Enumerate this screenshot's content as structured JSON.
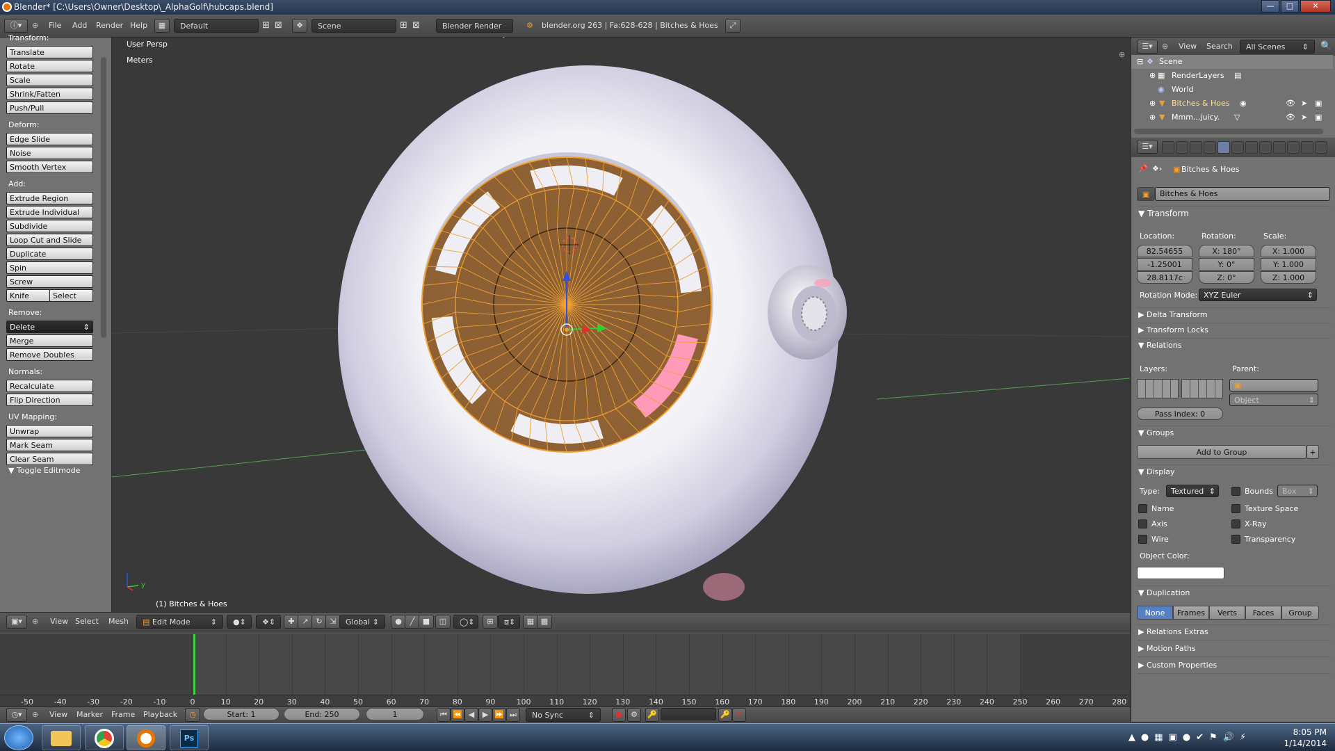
{
  "titlebar": {
    "title": "Blender* [C:\\Users\\Owner\\Desktop\\_AlphaGolf\\hubcaps.blend]"
  },
  "info_header": {
    "menus": [
      "File",
      "Add",
      "Render",
      "Help"
    ],
    "layout": "Default",
    "scene": "Scene",
    "engine": "Blender Render",
    "stats": "blender.org 263 | Fa:628-628 | Bitches & Hoes"
  },
  "toolshelf": {
    "transform_label": "Transform:",
    "transform": [
      "Translate",
      "Rotate",
      "Scale",
      "Shrink/Fatten",
      "Push/Pull"
    ],
    "deform_label": "Deform:",
    "deform": [
      "Edge Slide",
      "Noise",
      "Smooth Vertex"
    ],
    "add_label": "Add:",
    "add": [
      "Extrude Region",
      "Extrude Individual",
      "Subdivide",
      "Loop Cut and Slide",
      "Duplicate",
      "Spin",
      "Screw"
    ],
    "knife": "Knife",
    "select": "Select",
    "remove_label": "Remove:",
    "delete": "Delete",
    "remove": [
      "Merge",
      "Remove Doubles"
    ],
    "normals_label": "Normals:",
    "normals": [
      "Recalculate",
      "Flip Direction"
    ],
    "uv_label": "UV Mapping:",
    "uv": [
      "Unwrap",
      "Mark Seam",
      "Clear Seam"
    ],
    "toggle": "Toggle Editmode"
  },
  "viewport": {
    "view_name": "User Persp",
    "units": "Meters",
    "object_label": "(1) Bitches & Hoes",
    "axis_y": "y"
  },
  "viewport_header": {
    "menus": [
      "View",
      "Select",
      "Mesh"
    ],
    "mode": "Edit Mode",
    "orientation": "Global"
  },
  "timeline": {
    "ticks": [
      "-50",
      "-40",
      "-30",
      "-20",
      "-10",
      "0",
      "10",
      "20",
      "30",
      "40",
      "50",
      "60",
      "70",
      "80",
      "90",
      "100",
      "110",
      "120",
      "130",
      "140",
      "150",
      "160",
      "170",
      "180",
      "190",
      "200",
      "210",
      "220",
      "230",
      "240",
      "250",
      "260",
      "270",
      "280"
    ],
    "menus": [
      "View",
      "Marker",
      "Frame",
      "Playback"
    ],
    "start": "Start: 1",
    "end": "End: 250",
    "current": "1",
    "sync": "No Sync"
  },
  "outliner": {
    "menus": [
      "View",
      "Search"
    ],
    "filter": "All Scenes",
    "rows": [
      "Scene",
      "RenderLayers",
      "World",
      "Bitches & Hoes",
      "Mmm...juicy."
    ]
  },
  "properties": {
    "breadcrumb": "Bitches & Hoes",
    "object_name": "Bitches & Hoes",
    "transform": {
      "title": "Transform",
      "location_label": "Location:",
      "rotation_label": "Rotation:",
      "scale_label": "Scale:",
      "location": [
        "82.54655",
        "-1.25001",
        "28.8117c"
      ],
      "rotation": [
        "X: 180°",
        "Y: 0°",
        "Z: 0°"
      ],
      "scale": [
        "X: 1.000",
        "Y: 1.000",
        "Z: 1.000"
      ],
      "rotation_mode_label": "Rotation Mode:",
      "rotation_mode": "XYZ Euler"
    },
    "delta_transform": "Delta Transform",
    "transform_locks": "Transform Locks",
    "relations": {
      "title": "Relations",
      "layers_label": "Layers:",
      "parent_label": "Parent:",
      "parent_type": "Object",
      "pass_index": "Pass Index: 0"
    },
    "groups": {
      "title": "Groups",
      "add": "Add to Group"
    },
    "display": {
      "title": "Display",
      "type_label": "Type:",
      "type": "Textured",
      "bounds": "Bounds",
      "bounds_type": "Box",
      "name": "Name",
      "texture_space": "Texture Space",
      "axis": "Axis",
      "xray": "X-Ray",
      "wire": "Wire",
      "transparency": "Transparency",
      "color_label": "Object Color:"
    },
    "duplication": {
      "title": "Duplication",
      "options": [
        "None",
        "Frames",
        "Verts",
        "Faces",
        "Group"
      ]
    },
    "relations_extras": "Relations Extras",
    "motion_paths": "Motion Paths",
    "custom_properties": "Custom Properties"
  },
  "taskbar": {
    "time": "8:05 PM",
    "date": "1/14/2014",
    "ps": "Ps"
  },
  "colors": {
    "accent": "#f0a030",
    "panel": "#727272",
    "viewport": "#393939",
    "selected_tab": "#5680c2"
  }
}
